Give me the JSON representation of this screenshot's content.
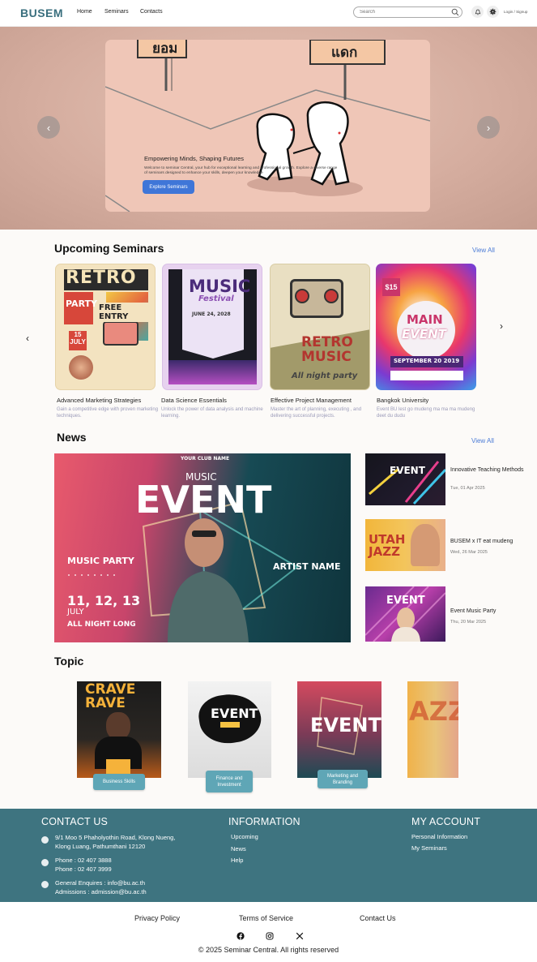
{
  "header": {
    "logo": "BUSEM",
    "nav": [
      "Home",
      "Seminars",
      "Contacts"
    ],
    "search_placeholder": "Search",
    "login": "Login / Signup"
  },
  "hero": {
    "title": "Empowering Minds, Shaping Futures",
    "description": "Welcome to seminar Central, your hub for exceptional learning and professional growth. Explore a diverse range of seminars designed to enhance your skills, deepen your knowledge",
    "button": "Explore Seminars",
    "sign_left": "ยอม",
    "sign_right": "แดก"
  },
  "upcoming": {
    "title": "Upcoming Seminars",
    "view_all": "View All",
    "items": [
      {
        "name": "Advanced Marketing Strategies",
        "desc": "Gain a competitive edge with proven marketing techniques.",
        "poster_a": "RETRO",
        "poster_b": "PARTY",
        "poster_c": "FREE ENTRY"
      },
      {
        "name": "Data Science Essentials",
        "desc": "Unlock the power of data analysis and machine learning.",
        "poster_a": "MUSIC",
        "poster_b": "Festival",
        "poster_c": "JUNE 24, 2028"
      },
      {
        "name": "Effective Project Management",
        "desc": "Master the art of planning, executing , and delivering successful projects.",
        "poster_a": "RETRO",
        "poster_b": "MUSIC",
        "poster_c": "All night party"
      },
      {
        "name": "Bangkok University",
        "desc": "Event BU lest go mudeng ma ma ma mudeng deet du dudu",
        "poster_a": "MAIN",
        "poster_b": "EVENT",
        "poster_c": "SEPTEMBER 20 2019"
      }
    ]
  },
  "news": {
    "title": "News",
    "view_all": "View All",
    "main": {
      "club": "YOUR CLUB NAME",
      "music": "MUSIC",
      "event": "EVENT",
      "party": "MUSIC PARTY",
      "dates": "11, 12, 13",
      "month": "JULY",
      "allnight": "ALL NIGHT LONG",
      "artist": "ARTIST NAME"
    },
    "items": [
      {
        "title": "Innovative Teaching Methods",
        "date": "Tue, 01 Apr 2025",
        "thumb": "EVENT"
      },
      {
        "title": "BUSEM x IT eat mudeng",
        "date": "Wed, 26 Mar 2025",
        "thumb": "UTAH JAZZ"
      },
      {
        "title": "Event Music Party",
        "date": "Thu, 20 Mar 2025",
        "thumb": "EVENT"
      }
    ]
  },
  "topic": {
    "title": "Topic",
    "items": [
      {
        "tag": "Business Skills",
        "poster": "CRAVE RAVE"
      },
      {
        "tag": "Finance and Investment",
        "poster": "EVENT"
      },
      {
        "tag": "Marketing and Branding",
        "poster": "EVENT"
      },
      {
        "tag": "",
        "poster": "AZZ"
      }
    ]
  },
  "footer": {
    "contact_title": "CONTACT US",
    "address": [
      "9/1 Moo 5 Phaholyothin Road, Klong Nueng,",
      "Klong Luang, Pathumthani 12120"
    ],
    "phone": [
      "Phone : 02 407 3888",
      "Phone : 02 407 3999"
    ],
    "email": [
      "General Enquires : info@bu.ac.th",
      "Admissions : admission@bu.ac.th"
    ],
    "info_title": "INFORMATION",
    "info_links": [
      "Upcoming",
      "News",
      "Help"
    ],
    "account_title": "MY ACCOUNT",
    "account_links": [
      "Personal Information",
      "My Seminars"
    ],
    "bottom_links": [
      "Privacy Policy",
      "Terms of Service",
      "Contact Us"
    ],
    "copyright": "© 2025 Seminar Central. All rights reserved"
  }
}
